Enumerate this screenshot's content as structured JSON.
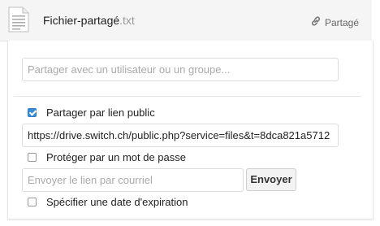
{
  "file": {
    "name": "Fichier-partagé",
    "extension": ".txt",
    "icon": "text-file-icon"
  },
  "header": {
    "shared_label": "Partagé",
    "shared_icon": "link-icon"
  },
  "share": {
    "user_search_placeholder": "Partager avec un utilisateur ou un groupe...",
    "public_link": {
      "label": "Partager par lien public",
      "checked": true,
      "url": "https://drive.switch.ch/public.php?service=files&t=8dca821a5712"
    },
    "password": {
      "label": "Protéger par un mot de passe",
      "checked": false
    },
    "email": {
      "placeholder": "Envoyer le lien par courriel",
      "send_label": "Envoyer"
    },
    "expiration": {
      "label": "Spécifier une date d'expiration",
      "checked": false
    }
  },
  "colors": {
    "accent": "#3b8dd9",
    "header_bg": "#f5f5f5"
  }
}
